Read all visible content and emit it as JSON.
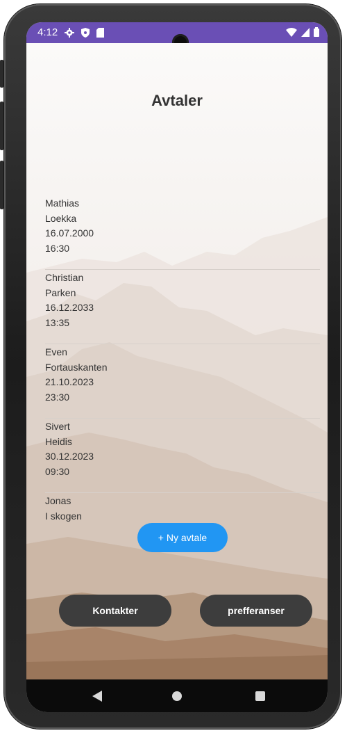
{
  "status_bar": {
    "time": "4:12",
    "left_icons": [
      "gear-icon",
      "shield-icon",
      "sd-card-icon"
    ],
    "right_icons": [
      "wifi-icon",
      "signal-icon",
      "battery-icon"
    ],
    "color": "#6a4fb5"
  },
  "header": {
    "title": "Avtaler"
  },
  "appointments": [
    {
      "name": "Mathias",
      "place": "Loekka",
      "date": "16.07.2000",
      "time": "16:30"
    },
    {
      "name": "Christian",
      "place": "Parken",
      "date": "16.12.2033",
      "time": "13:35"
    },
    {
      "name": "Even",
      "place": "Fortauskanten",
      "date": "21.10.2023",
      "time": "23:30"
    },
    {
      "name": "Sivert",
      "place": "Heidis",
      "date": "30.12.2023",
      "time": "09:30"
    },
    {
      "name": "Jonas",
      "place": "I skogen",
      "date": "",
      "time": ""
    }
  ],
  "actions": {
    "new_appointment": "+ Ny avtale",
    "contacts": "Kontakter",
    "preferences": "prefferanser"
  },
  "nav": {
    "icons": [
      "back-icon",
      "home-icon",
      "recents-icon"
    ]
  },
  "colors": {
    "accent": "#2196f3",
    "dark_button": "#3d3d3d"
  }
}
